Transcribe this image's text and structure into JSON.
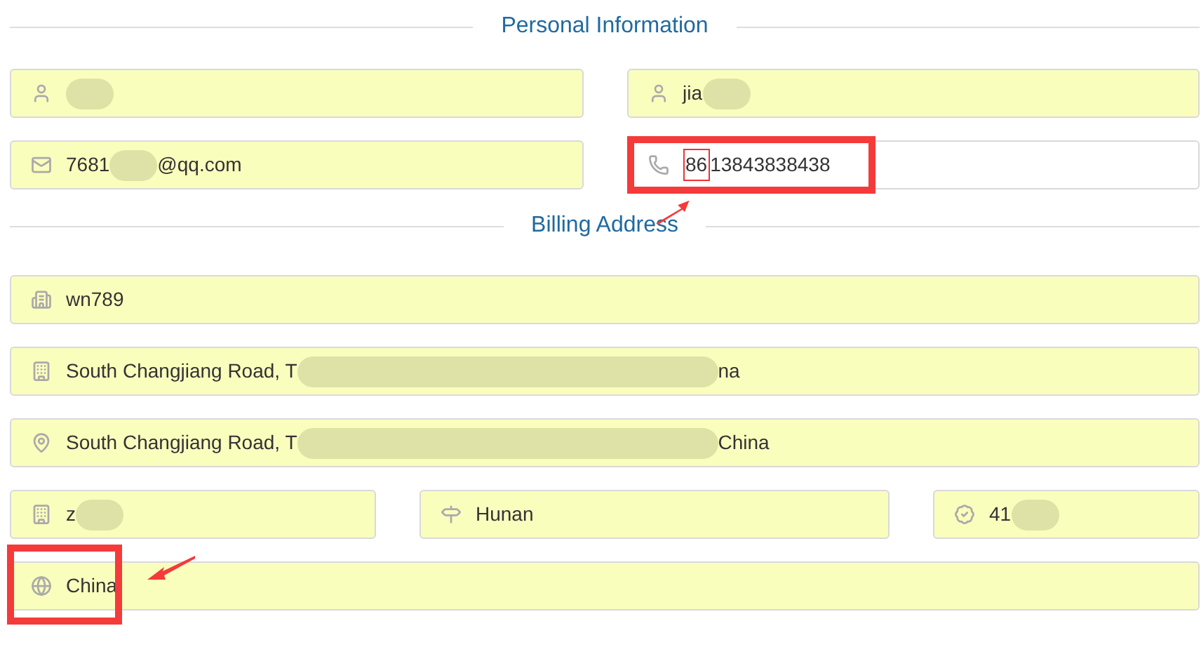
{
  "sections": [
    {
      "title": "Personal Information",
      "rows": [
        {
          "fields": [
            {
              "kind": "user",
              "autofilled": true,
              "annotated": false,
              "parts": [
                {
                  "kind": "blur"
                }
              ]
            },
            {
              "kind": "user",
              "autofilled": true,
              "annotated": false,
              "parts": [
                {
                  "kind": "text",
                  "text": "jia"
                },
                {
                  "kind": "blur"
                }
              ]
            }
          ]
        },
        {
          "fields": [
            {
              "kind": "mail",
              "autofilled": true,
              "annotated": false,
              "parts": [
                {
                  "kind": "text",
                  "text": "7681"
                },
                {
                  "kind": "blur"
                },
                {
                  "kind": "text",
                  "text": "@qq.com"
                }
              ]
            },
            {
              "kind": "phone",
              "autofilled": false,
              "annotated": true,
              "parts": [
                {
                  "kind": "boxed",
                  "text": "86"
                },
                {
                  "kind": "text",
                  "text": "13843838438"
                }
              ]
            }
          ]
        }
      ]
    },
    {
      "title": "Billing Address",
      "rows": [
        {
          "fields": [
            {
              "kind": "building",
              "autofilled": true,
              "annotated": false,
              "parts": [
                {
                  "kind": "text",
                  "text": "wn789"
                }
              ]
            }
          ]
        },
        {
          "fields": [
            {
              "kind": "office",
              "autofilled": true,
              "annotated": false,
              "parts": [
                {
                  "kind": "text",
                  "text": "South Changjiang Road, T"
                },
                {
                  "kind": "blurwide"
                },
                {
                  "kind": "text",
                  "text": "na"
                }
              ]
            }
          ]
        },
        {
          "fields": [
            {
              "kind": "pin",
              "autofilled": true,
              "annotated": false,
              "parts": [
                {
                  "kind": "text",
                  "text": "South Changjiang Road, T"
                },
                {
                  "kind": "blurwide"
                },
                {
                  "kind": "text",
                  "text": "China"
                }
              ]
            }
          ]
        },
        {
          "fields": [
            {
              "kind": "office",
              "autofilled": true,
              "annotated": false,
              "parts": [
                {
                  "kind": "text",
                  "text": "z"
                },
                {
                  "kind": "blur"
                }
              ]
            },
            {
              "kind": "signpost",
              "autofilled": true,
              "annotated": false,
              "parts": [
                {
                  "kind": "text",
                  "text": "Hunan"
                }
              ]
            },
            {
              "kind": "seal",
              "autofilled": true,
              "annotated": false,
              "parts": [
                {
                  "kind": "text",
                  "text": "41"
                },
                {
                  "kind": "blur"
                }
              ]
            }
          ]
        },
        {
          "fields": [
            {
              "kind": "globe",
              "autofilled": true,
              "annotated": true,
              "parts": [
                {
                  "kind": "text",
                  "text": "China"
                }
              ]
            }
          ]
        }
      ]
    }
  ]
}
